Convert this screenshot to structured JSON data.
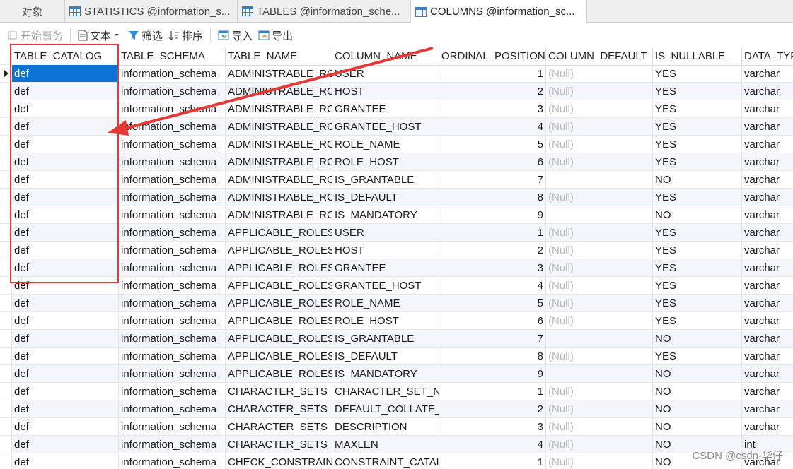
{
  "tabs": {
    "objects": "对象",
    "items": [
      {
        "label": "STATISTICS @information_s..."
      },
      {
        "label": "TABLES @information_sche..."
      },
      {
        "label": "COLUMNS @information_sc..."
      }
    ]
  },
  "toolbar": {
    "begin_tx": "开始事务",
    "text": "文本",
    "filter": "筛选",
    "sort": "排序",
    "import": "导入",
    "export": "导出"
  },
  "columns": [
    "TABLE_CATALOG",
    "TABLE_SCHEMA",
    "TABLE_NAME",
    "COLUMN_NAME",
    "ORDINAL_POSITION",
    "COLUMN_DEFAULT",
    "IS_NULLABLE",
    "DATA_TYPE"
  ],
  "rows": [
    [
      "def",
      "information_schema",
      "ADMINISTRABLE_ROLE_AUTHORIZATIONS",
      "USER",
      "1",
      "(Null)",
      "YES",
      "varchar"
    ],
    [
      "def",
      "information_schema",
      "ADMINISTRABLE_ROLE_AUTHORIZATIONS",
      "HOST",
      "2",
      "(Null)",
      "YES",
      "varchar"
    ],
    [
      "def",
      "information_schema",
      "ADMINISTRABLE_ROLE_AUTHORIZATIONS",
      "GRANTEE",
      "3",
      "(Null)",
      "YES",
      "varchar"
    ],
    [
      "def",
      "information_schema",
      "ADMINISTRABLE_ROLE_AUTHORIZATIONS",
      "GRANTEE_HOST",
      "4",
      "(Null)",
      "YES",
      "varchar"
    ],
    [
      "def",
      "information_schema",
      "ADMINISTRABLE_ROLE_AUTHORIZATIONS",
      "ROLE_NAME",
      "5",
      "(Null)",
      "YES",
      "varchar"
    ],
    [
      "def",
      "information_schema",
      "ADMINISTRABLE_ROLE_AUTHORIZATIONS",
      "ROLE_HOST",
      "6",
      "(Null)",
      "YES",
      "varchar"
    ],
    [
      "def",
      "information_schema",
      "ADMINISTRABLE_ROLE_AUTHORIZATIONS",
      "IS_GRANTABLE",
      "7",
      "",
      "NO",
      "varchar"
    ],
    [
      "def",
      "information_schema",
      "ADMINISTRABLE_ROLE_AUTHORIZATIONS",
      "IS_DEFAULT",
      "8",
      "(Null)",
      "YES",
      "varchar"
    ],
    [
      "def",
      "information_schema",
      "ADMINISTRABLE_ROLE_AUTHORIZATIONS",
      "IS_MANDATORY",
      "9",
      "",
      "NO",
      "varchar"
    ],
    [
      "def",
      "information_schema",
      "APPLICABLE_ROLES",
      "USER",
      "1",
      "(Null)",
      "YES",
      "varchar"
    ],
    [
      "def",
      "information_schema",
      "APPLICABLE_ROLES",
      "HOST",
      "2",
      "(Null)",
      "YES",
      "varchar"
    ],
    [
      "def",
      "information_schema",
      "APPLICABLE_ROLES",
      "GRANTEE",
      "3",
      "(Null)",
      "YES",
      "varchar"
    ],
    [
      "def",
      "information_schema",
      "APPLICABLE_ROLES",
      "GRANTEE_HOST",
      "4",
      "(Null)",
      "YES",
      "varchar"
    ],
    [
      "def",
      "information_schema",
      "APPLICABLE_ROLES",
      "ROLE_NAME",
      "5",
      "(Null)",
      "YES",
      "varchar"
    ],
    [
      "def",
      "information_schema",
      "APPLICABLE_ROLES",
      "ROLE_HOST",
      "6",
      "(Null)",
      "YES",
      "varchar"
    ],
    [
      "def",
      "information_schema",
      "APPLICABLE_ROLES",
      "IS_GRANTABLE",
      "7",
      "",
      "NO",
      "varchar"
    ],
    [
      "def",
      "information_schema",
      "APPLICABLE_ROLES",
      "IS_DEFAULT",
      "8",
      "(Null)",
      "YES",
      "varchar"
    ],
    [
      "def",
      "information_schema",
      "APPLICABLE_ROLES",
      "IS_MANDATORY",
      "9",
      "",
      "NO",
      "varchar"
    ],
    [
      "def",
      "information_schema",
      "CHARACTER_SETS",
      "CHARACTER_SET_NAME",
      "1",
      "(Null)",
      "NO",
      "varchar"
    ],
    [
      "def",
      "information_schema",
      "CHARACTER_SETS",
      "DEFAULT_COLLATE_NAME",
      "2",
      "(Null)",
      "NO",
      "varchar"
    ],
    [
      "def",
      "information_schema",
      "CHARACTER_SETS",
      "DESCRIPTION",
      "3",
      "(Null)",
      "NO",
      "varchar"
    ],
    [
      "def",
      "information_schema",
      "CHARACTER_SETS",
      "MAXLEN",
      "4",
      "(Null)",
      "NO",
      "int"
    ],
    [
      "def",
      "information_schema",
      "CHECK_CONSTRAINTS",
      "CONSTRAINT_CATALOG",
      "1",
      "(Null)",
      "NO",
      "varchar"
    ]
  ],
  "selected_row": 0,
  "watermark": "CSDN @csdn-华仔",
  "colors": {
    "accent": "#0b73d4",
    "annotation": "#e53935",
    "alt_row": "#f3f7fc"
  }
}
